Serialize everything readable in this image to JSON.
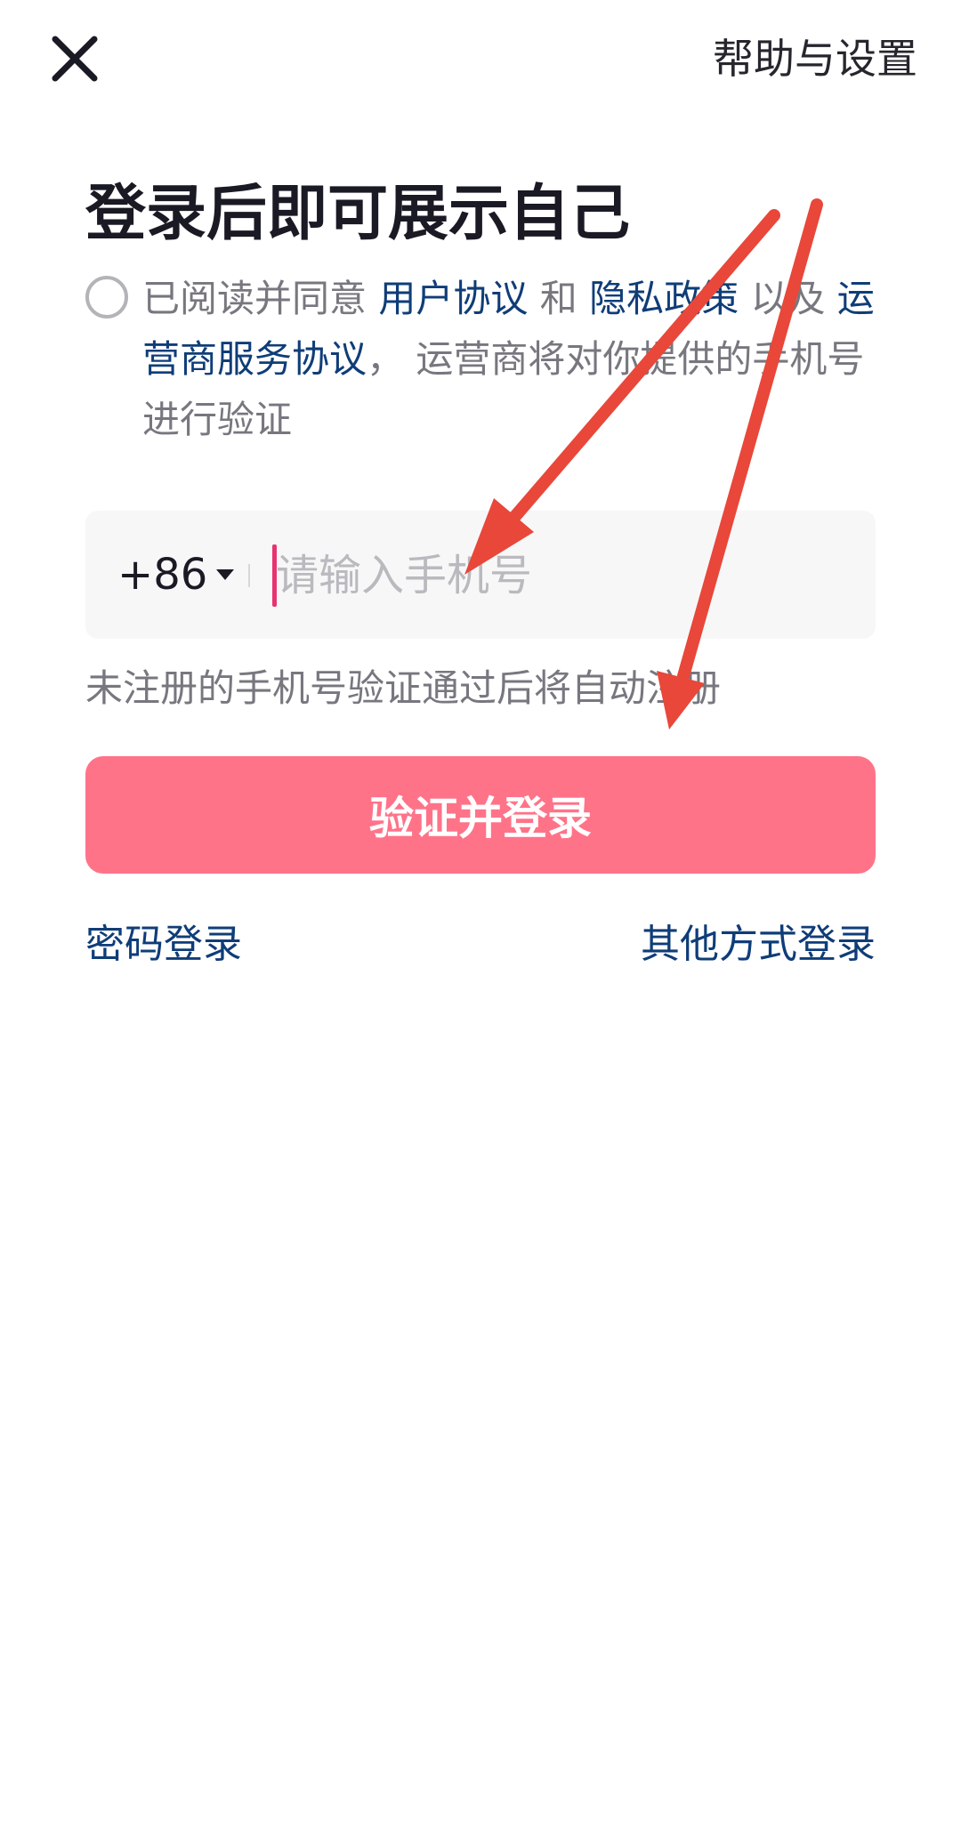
{
  "header": {
    "close_icon": "close-icon",
    "help_label": "帮助与设置"
  },
  "title": "登录后即可展示自己",
  "agreement": {
    "prefix": "已阅读并同意 ",
    "user_agreement": "用户协议",
    "and": " 和 ",
    "privacy_policy": "隐私政策",
    "and_also": " 以及 ",
    "carrier_agreement": "运营商服务协议",
    "suffix": "， 运营商将对你提供的手机号进行验证"
  },
  "phone": {
    "country_code": "+86",
    "value": "",
    "placeholder": "请输入手机号"
  },
  "hint": "未注册的手机号验证通过后将自动注册",
  "submit_label": "验证并登录",
  "links": {
    "password_login": "密码登录",
    "other_login": "其他方式登录"
  },
  "colors": {
    "primary_button": "#ff7389",
    "link": "#0f3d78",
    "cursor": "#e8336f",
    "annotation_arrow": "#e8473a"
  }
}
